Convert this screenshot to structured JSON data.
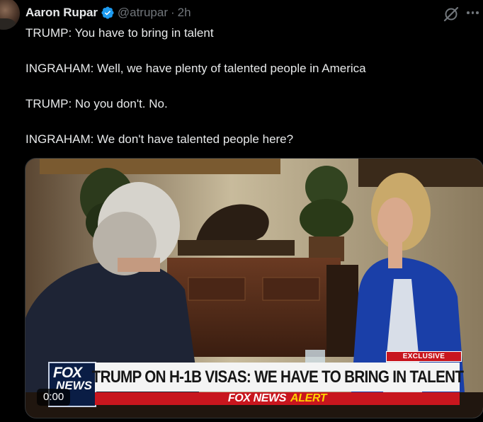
{
  "author": {
    "name": "Aaron Rupar",
    "handle": "@atrupar",
    "separator": "·",
    "time": "2h",
    "verified_color": "#1d9bf0"
  },
  "tweet": {
    "lines": [
      "TRUMP: You have to bring in talent",
      "INGRAHAM: Well, we have plenty of talented people in America",
      "TRUMP: No you don't. No.",
      "INGRAHAM: We don't have talented people here?"
    ]
  },
  "media": {
    "exclusive_label": "EXCLUSIVE",
    "headline": "TRUMP ON H-1B VISAS: WE HAVE TO BRING IN TALENT",
    "alert_brand": "FOX NEWS",
    "alert_word": "ALERT",
    "logo_line1": "FOX",
    "logo_line2": "NEWS",
    "timestamp": "0:00"
  },
  "icons": {
    "grok": "grok-icon",
    "more": "more-icon",
    "verified": "verified-badge-icon"
  },
  "colors": {
    "background": "#000000",
    "text": "#e7e9ea",
    "muted": "#71767b",
    "fox_red": "#c8161e",
    "fox_navy": "#0a1d45",
    "alert_yellow": "#ffd200"
  }
}
